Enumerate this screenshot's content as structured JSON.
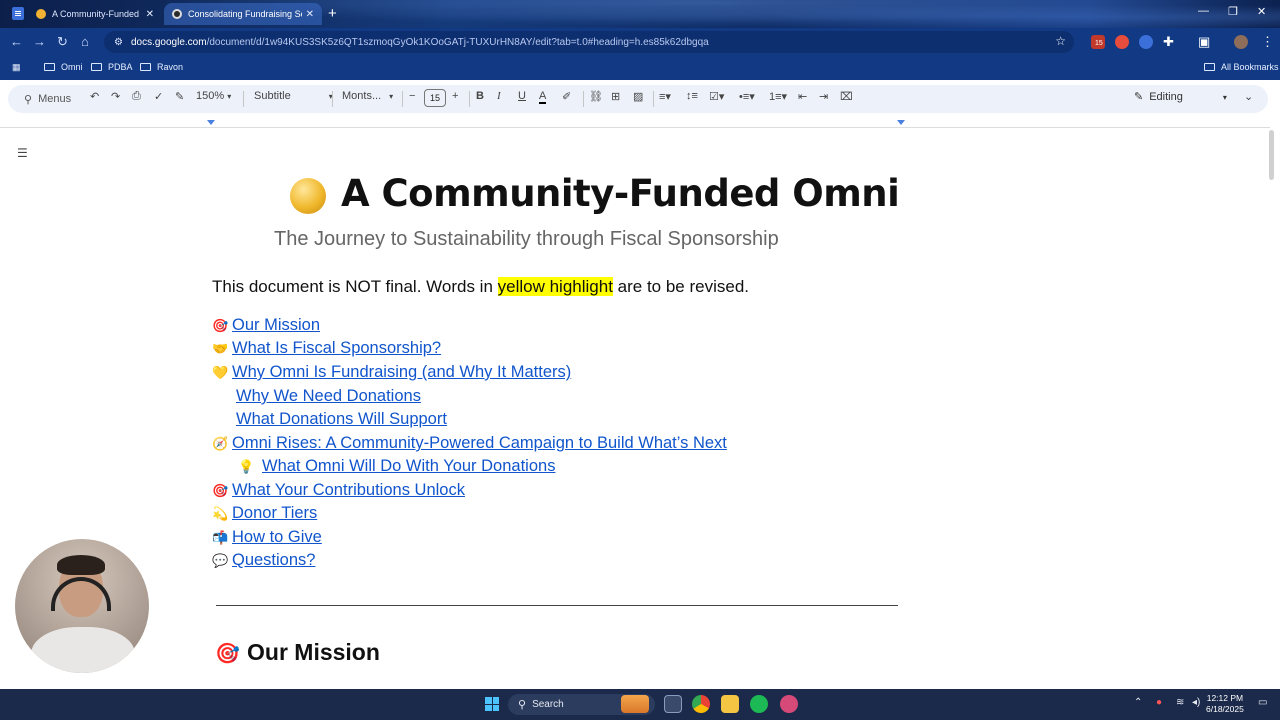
{
  "browser": {
    "tabs": [
      {
        "title": "A Community-Funded Omni",
        "active": false
      },
      {
        "title": "Consolidating Fundraising Secti",
        "active": true
      }
    ],
    "url_host": "docs.google.com",
    "url_path": "/document/d/1w94KUS3SK5z6QT1szmoqGyOk1KOoGATj-TUXUrHN8AY/edit?tab=t.0#heading=h.es85k62dbgqa",
    "bookmarks": [
      "Omni",
      "PDBA",
      "Ravon"
    ],
    "all_bookmarks": "All Bookmarks",
    "ext_badge": "15"
  },
  "toolbar": {
    "menus": "Menus",
    "zoom": "150%",
    "style": "Subtitle",
    "font": "Monts...",
    "font_size": "15",
    "mode": "Editing"
  },
  "document": {
    "title": "A Community-Funded Omni",
    "subtitle": "The Journey to Sustainability through Fiscal Sponsorship",
    "notice_before": "This document is NOT final. Words in ",
    "notice_highlight": "yellow highlight",
    "notice_after": " are to be revised.",
    "toc": [
      {
        "emoji": "🎯",
        "label": "Our Mission"
      },
      {
        "emoji": "🤝",
        "label": "What Is Fiscal Sponsorship?"
      },
      {
        "emoji": "💛",
        "label": "Why Omni Is Fundraising (and Why It Matters)"
      },
      {
        "emoji": "",
        "label": "Why We Need Donations"
      },
      {
        "emoji": "",
        "label": "What Donations Will Support"
      },
      {
        "emoji": "🧭",
        "label": "Omni Rises: A Community-Powered Campaign to Build What’s Next"
      },
      {
        "emoji": "💡",
        "label": "What Omni Will Do With Your Donations"
      },
      {
        "emoji": "🎯",
        "label": "What Your Contributions Unlock"
      },
      {
        "emoji": "💫",
        "label": "Donor Tiers"
      },
      {
        "emoji": "📬",
        "label": "How to Give"
      },
      {
        "emoji": "💬",
        "label": "Questions?"
      }
    ],
    "section_heading_emoji": "🎯",
    "section_heading": "Our Mission"
  },
  "taskbar": {
    "search": "Search",
    "time": "12:12 PM",
    "date": "6/18/2025"
  },
  "colors": {
    "link": "#1155cc",
    "highlight": "#ffff00",
    "chrome": "#123a84"
  }
}
